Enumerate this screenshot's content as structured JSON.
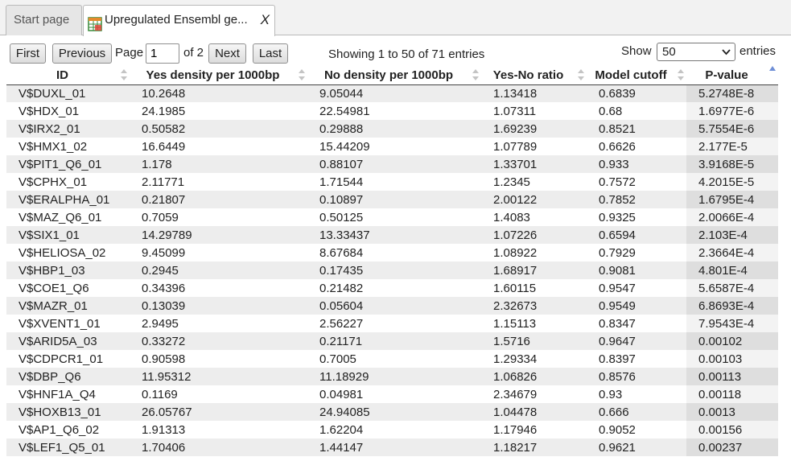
{
  "tabs": [
    {
      "label": "Start page"
    },
    {
      "label": "Upregulated Ensembl ge...",
      "close": "X"
    }
  ],
  "pager": {
    "first": "First",
    "previous": "Previous",
    "page_label": "Page",
    "page_value": "1",
    "of_label": "of 2",
    "next": "Next",
    "last": "Last",
    "info": "Showing 1 to 50 of 71 entries",
    "show_label": "Show",
    "show_value": "50",
    "entries_label": "entries"
  },
  "table": {
    "columns": [
      "ID",
      "Yes density per 1000bp",
      "No density per 1000bp",
      "Yes-No ratio",
      "Model cutoff",
      "P-value"
    ],
    "sorted_column": "P-value",
    "sort_direction": "ascending",
    "rows": [
      [
        "V$DUXL_01",
        "10.2648",
        "9.05044",
        "1.13418",
        "0.6839",
        "5.2748E-8"
      ],
      [
        "V$HDX_01",
        "24.1985",
        "22.54981",
        "1.07311",
        "0.68",
        "1.6977E-6"
      ],
      [
        "V$IRX2_01",
        "0.50582",
        "0.29888",
        "1.69239",
        "0.8521",
        "5.7554E-6"
      ],
      [
        "V$HMX1_02",
        "16.6449",
        "15.44209",
        "1.07789",
        "0.6626",
        "2.177E-5"
      ],
      [
        "V$PIT1_Q6_01",
        "1.178",
        "0.88107",
        "1.33701",
        "0.933",
        "3.9168E-5"
      ],
      [
        "V$CPHX_01",
        "2.11771",
        "1.71544",
        "1.2345",
        "0.7572",
        "4.2015E-5"
      ],
      [
        "V$ERALPHA_01",
        "0.21807",
        "0.10897",
        "2.00122",
        "0.7852",
        "1.6795E-4"
      ],
      [
        "V$MAZ_Q6_01",
        "0.7059",
        "0.50125",
        "1.4083",
        "0.9325",
        "2.0066E-4"
      ],
      [
        "V$SIX1_01",
        "14.29789",
        "13.33437",
        "1.07226",
        "0.6594",
        "2.103E-4"
      ],
      [
        "V$HELIOSA_02",
        "9.45099",
        "8.67684",
        "1.08922",
        "0.7929",
        "2.3664E-4"
      ],
      [
        "V$HBP1_03",
        "0.2945",
        "0.17435",
        "1.68917",
        "0.9081",
        "4.801E-4"
      ],
      [
        "V$COE1_Q6",
        "0.34396",
        "0.21482",
        "1.60115",
        "0.9547",
        "5.6587E-4"
      ],
      [
        "V$MAZR_01",
        "0.13039",
        "0.05604",
        "2.32673",
        "0.9549",
        "6.8693E-4"
      ],
      [
        "V$XVENT1_01",
        "2.9495",
        "2.56227",
        "1.15113",
        "0.8347",
        "7.9543E-4"
      ],
      [
        "V$ARID5A_03",
        "0.33272",
        "0.21171",
        "1.5716",
        "0.9647",
        "0.00102"
      ],
      [
        "V$CDPCR1_01",
        "0.90598",
        "0.7005",
        "1.29334",
        "0.8397",
        "0.00103"
      ],
      [
        "V$DBP_Q6",
        "11.95312",
        "11.18929",
        "1.06826",
        "0.8576",
        "0.00113"
      ],
      [
        "V$HNF1A_Q4",
        "0.1169",
        "0.04981",
        "2.34679",
        "0.93",
        "0.00118"
      ],
      [
        "V$HOXB13_01",
        "26.05767",
        "24.94085",
        "1.04478",
        "0.666",
        "0.0013"
      ],
      [
        "V$AP1_Q6_02",
        "1.91313",
        "1.62204",
        "1.17946",
        "0.9052",
        "0.00156"
      ],
      [
        "V$LEF1_Q5_01",
        "1.70406",
        "1.44147",
        "1.18217",
        "0.9621",
        "0.00237"
      ]
    ]
  },
  "colors": {
    "row_odd": "#ededed",
    "sorted_odd": "#dedede",
    "sort_active": "#6f8fd6",
    "sort_inactive": "#c4c4c4"
  }
}
